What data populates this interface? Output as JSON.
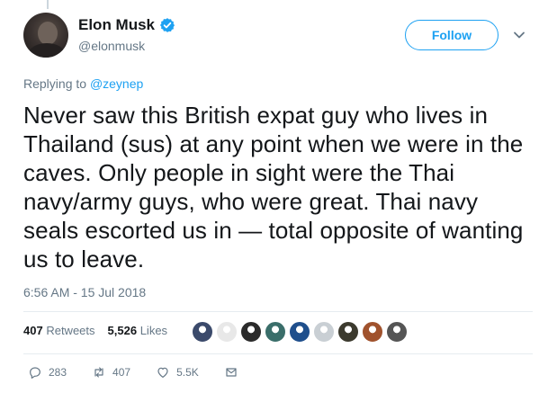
{
  "tweet": {
    "author": {
      "display_name": "Elon Musk",
      "handle": "@elonmusk",
      "verified": true
    },
    "follow_label": "Follow",
    "replying_prefix": "Replying to",
    "replying_to": "@zeynep",
    "text": "Never saw this British expat guy who lives in Thailand (sus) at any point when we were in the caves. Only people in sight were the Thai navy/army guys, who were great. Thai navy seals escorted us in — total opposite of wanting us to leave.",
    "timestamp": "6:56 AM - 15 Jul 2018",
    "stats": {
      "retweets_count": "407",
      "retweets_label": "Retweets",
      "likes_count": "5,526",
      "likes_label": "Likes"
    },
    "actions": {
      "reply_count": "283",
      "retweet_count": "407",
      "like_count": "5.5K"
    }
  },
  "icons": {
    "verified": "verified-badge-icon",
    "caret": "chevron-down-icon",
    "reply": "reply-icon",
    "retweet": "retweet-icon",
    "like": "heart-icon",
    "dm": "envelope-icon"
  },
  "colors": {
    "accent": "#1da1f2",
    "secondary_text": "#657786",
    "primary_text": "#14171a",
    "divider": "#e6ecf0"
  },
  "liker_avatars": [
    "#3b4a6b",
    "#e8e8e8",
    "#2b2b2b",
    "#3a6e6a",
    "#1f4f8c",
    "#c9cfd4",
    "#3c3a2e",
    "#a0522d",
    "#555555"
  ]
}
